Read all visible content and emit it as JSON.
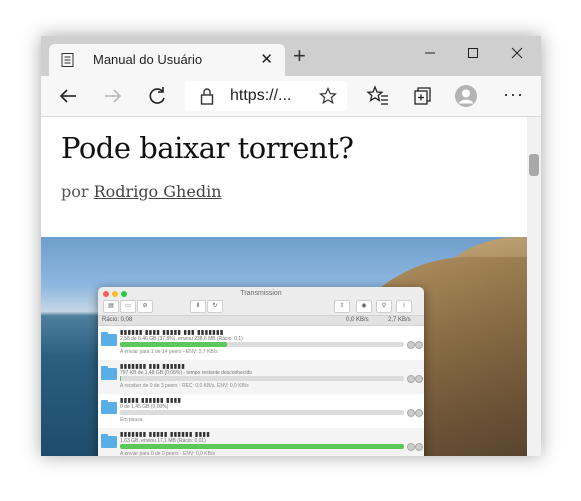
{
  "browser": {
    "tab": {
      "title": "Manual do Usuário",
      "close_glyph": "✕",
      "icon": "page-icon"
    },
    "new_tab_glyph": "+",
    "window_controls": [
      "minimize-icon",
      "maximize-icon",
      "close-icon"
    ],
    "address": {
      "text": "https://...",
      "lock_icon": "lock-icon",
      "favorite_icon": "star-icon"
    },
    "toolbar_icons": [
      "back-arrow-icon",
      "forward-arrow-icon",
      "refresh-icon",
      "favorites-icon",
      "collections-icon",
      "profile-icon",
      "more-icon"
    ],
    "toolbar_glyphs": {
      "back": "←",
      "forward": "→",
      "refresh": "↻",
      "favorite": "☆",
      "more": "···"
    }
  },
  "article": {
    "title": "Pode baixar torrent?",
    "byline_prefix": "por",
    "author": "Rodrigo Ghedin"
  },
  "screenshot": {
    "app_title": "Transmission",
    "status": {
      "ratio": "Rácio: 0,08",
      "down": "0,0 KB/s",
      "up": "2,7 KB/s"
    },
    "torrents": [
      {
        "info": "2,58 de 6,46 GB (37,8%), enviou 238,6 MB (Rácio: 0,1)",
        "progress": 0.378,
        "status": "A enviar para 1 de 14 peers - ENV: 2,7 KB/s"
      },
      {
        "info": "797 KB de 1,48 GB (0,05%) - tempo restante desconhecido",
        "progress": 0.0005,
        "status": "A receber de 0 de 3 peers - REC: 0,0 KB/s, ENV: 0,0 KB/s"
      },
      {
        "info": "0 de 1,45 GB (0,00%)",
        "progress": 0.0,
        "status": "Em pausa"
      },
      {
        "info": "1,63 GB, enviou 17,1 MB (Rácio: 0,01)",
        "progress": 1.0,
        "status": "A enviar para 0 de 0 peers - ENV: 0,0 KB/s"
      }
    ],
    "colors": {
      "progress": "#5cc85c",
      "folder": "#5aaee8"
    }
  }
}
